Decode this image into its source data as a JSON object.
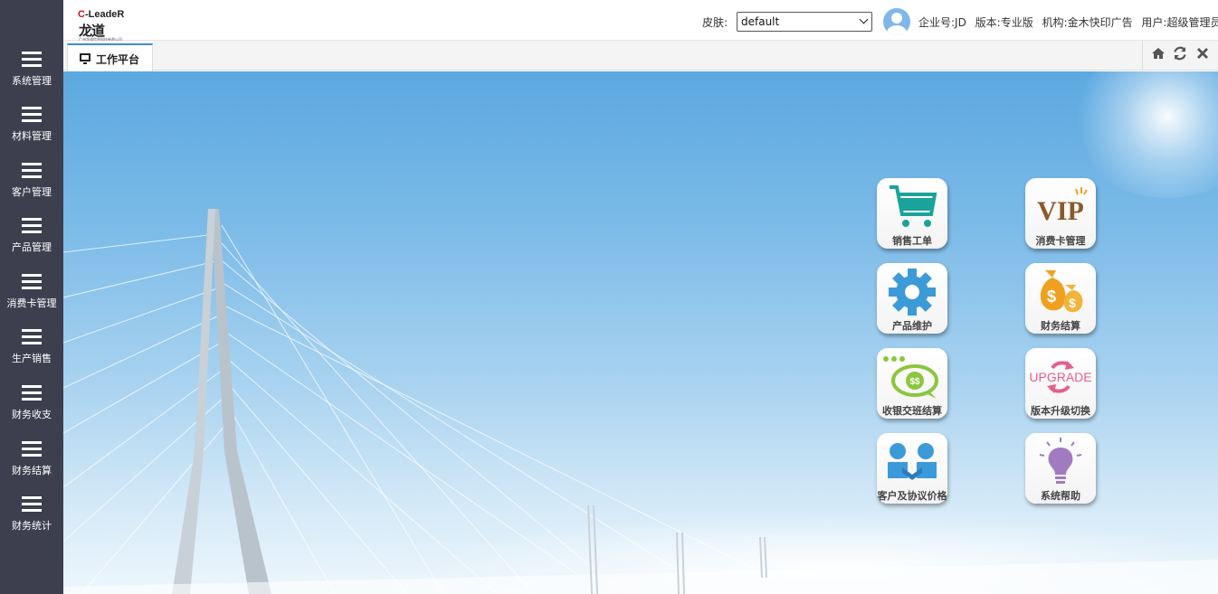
{
  "sidebar": {
    "items": [
      {
        "label": "系统管理"
      },
      {
        "label": "材料管理"
      },
      {
        "label": "客户管理"
      },
      {
        "label": "产品管理"
      },
      {
        "label": "消费卡管理"
      },
      {
        "label": "生产销售"
      },
      {
        "label": "财务收支"
      },
      {
        "label": "财务结算"
      },
      {
        "label": "财务统计"
      }
    ]
  },
  "header": {
    "logo_en_prefix": "C",
    "logo_en_rest": "-LeadeR",
    "logo_cn": "龙道",
    "logo_small": "广州龙道信息科技有限公司",
    "skin_label": "皮肤:",
    "skin_value": "default",
    "company": "企业号:JD",
    "edition": "版本:专业版",
    "org": "机构:金木快印广告",
    "user": "用户:超级管理员"
  },
  "tabs": {
    "active_label": "工作平台",
    "home_icon": "home-icon",
    "refresh_icon": "refresh-icon",
    "close_icon": "close-icon"
  },
  "tiles": [
    {
      "label": "销售工单",
      "icon": "cart-icon",
      "color": "#1aa39a"
    },
    {
      "label": "消费卡管理",
      "icon": "vip-icon",
      "color": "#8a5a2b",
      "icon_text": "VIP"
    },
    {
      "label": "产品维护",
      "icon": "gear-icon",
      "color": "#3d9ad8"
    },
    {
      "label": "财务结算",
      "icon": "money-bag-icon",
      "color": "#f0a020"
    },
    {
      "label": "收银交班结算",
      "icon": "cash-bubble-icon",
      "color": "#8cc63f"
    },
    {
      "label": "版本升级切换",
      "icon": "upgrade-icon",
      "color": "#e4608a",
      "icon_text": "UPGRADE"
    },
    {
      "label": "客户及协议价格",
      "icon": "handshake-icon",
      "color": "#3d9ad8"
    },
    {
      "label": "系统帮助",
      "icon": "lightbulb-icon",
      "color": "#a07bc0"
    }
  ]
}
